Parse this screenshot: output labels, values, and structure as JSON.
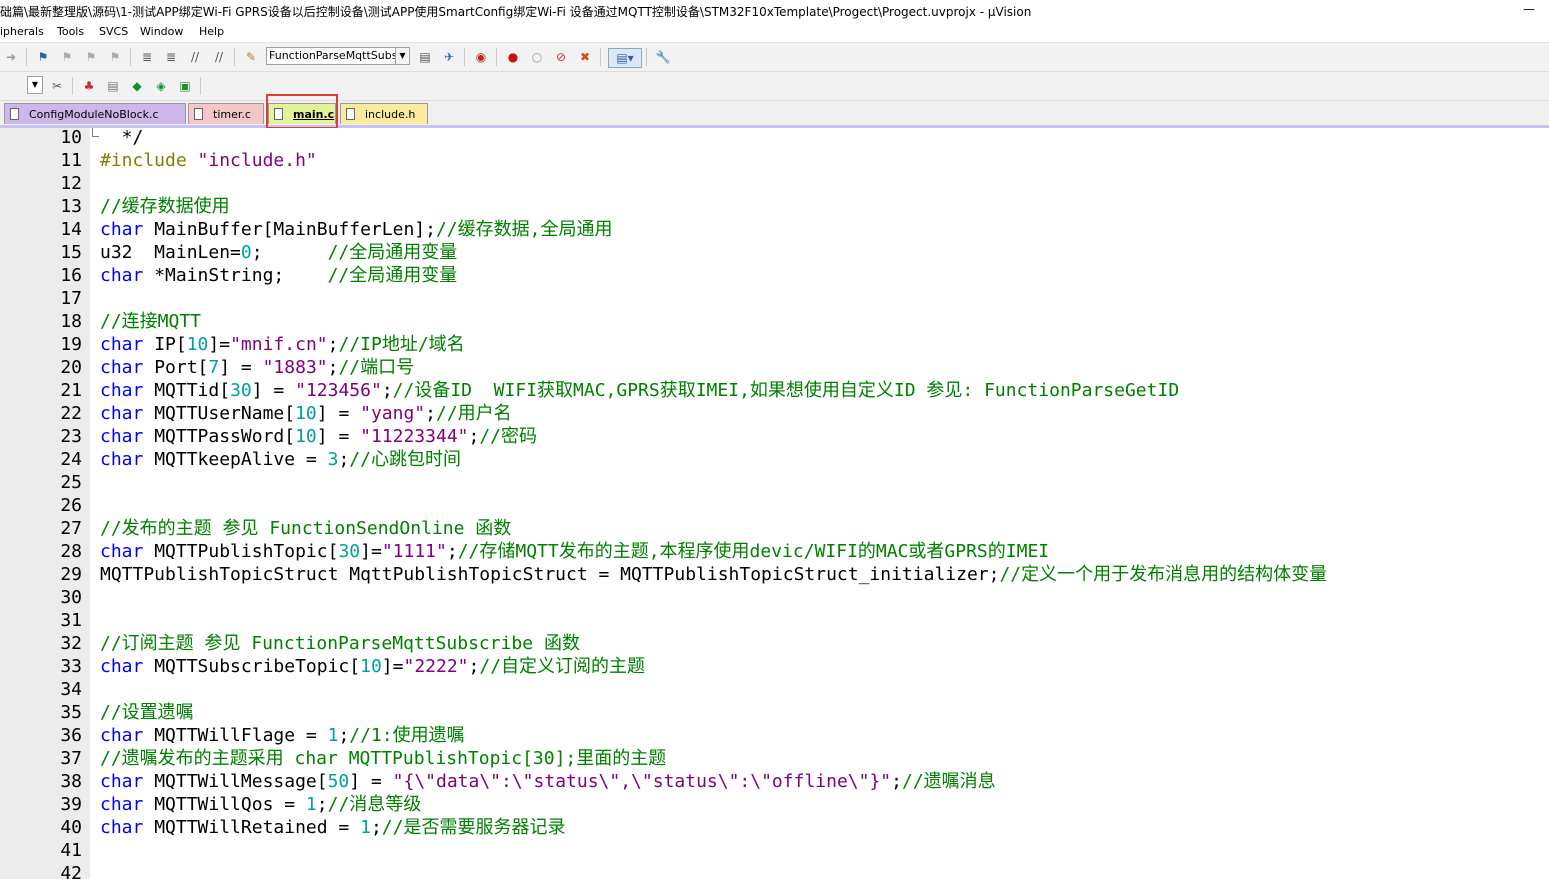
{
  "window": {
    "title": "础篇\\最新整理版\\源码\\1-测试APP绑定Wi-Fi  GPRS设备以后控制设备\\测试APP使用SmartConfig绑定Wi-Fi 设备通过MQTT控制设备\\STM32F10xTemplate\\Progect\\Progect.uvprojx - µVision",
    "minimize": "—"
  },
  "menu": [
    "ipherals",
    "Tools",
    "SVCS",
    "Window",
    "Help"
  ],
  "toolbar": {
    "function_combo": "FunctionParseMqttSubsc"
  },
  "tabs": [
    {
      "label": "ConfigModuleNoBlock.c",
      "color": "#cdb6e8"
    },
    {
      "label": "timer.c",
      "color": "#f3c7c7"
    },
    {
      "label": "main.c",
      "color": "#e6f29a"
    },
    {
      "label": "include.h",
      "color": "#fbeaa0"
    }
  ],
  "active_tab": "main.c",
  "code": {
    "lines": [
      {
        "n": "10",
        "t": [
          [
            "op",
            "  */"
          ]
        ]
      },
      {
        "n": "11",
        "t": [
          [
            "pp",
            "#include "
          ],
          [
            "st",
            "\"include.h\""
          ]
        ]
      },
      {
        "n": "12",
        "t": []
      },
      {
        "n": "13",
        "t": [
          [
            "cm",
            "//缓存数据使用"
          ]
        ]
      },
      {
        "n": "14",
        "t": [
          [
            "kw",
            "char"
          ],
          [
            "op",
            " MainBuffer[MainBufferLen];"
          ],
          [
            "cm",
            "//缓存数据,全局通用"
          ]
        ]
      },
      {
        "n": "15",
        "t": [
          [
            "op",
            "u32  MainLen="
          ],
          [
            "nm",
            "0"
          ],
          [
            "op",
            ";      "
          ],
          [
            "cm",
            "//全局通用变量"
          ]
        ]
      },
      {
        "n": "16",
        "t": [
          [
            "kw",
            "char"
          ],
          [
            "op",
            " *MainString;    "
          ],
          [
            "cm",
            "//全局通用变量"
          ]
        ]
      },
      {
        "n": "17",
        "t": []
      },
      {
        "n": "18",
        "t": [
          [
            "cm",
            "//连接MQTT"
          ]
        ]
      },
      {
        "n": "19",
        "t": [
          [
            "kw",
            "char"
          ],
          [
            "op",
            " IP["
          ],
          [
            "nm",
            "10"
          ],
          [
            "op",
            "]="
          ],
          [
            "st",
            "\"mnif.cn\""
          ],
          [
            "op",
            ";"
          ],
          [
            "cm",
            "//IP地址/域名"
          ]
        ]
      },
      {
        "n": "20",
        "t": [
          [
            "kw",
            "char"
          ],
          [
            "op",
            " Port["
          ],
          [
            "nm",
            "7"
          ],
          [
            "op",
            "] = "
          ],
          [
            "st",
            "\"1883\""
          ],
          [
            "op",
            ";"
          ],
          [
            "cm",
            "//端口号"
          ]
        ]
      },
      {
        "n": "21",
        "t": [
          [
            "kw",
            "char"
          ],
          [
            "op",
            " MQTTid["
          ],
          [
            "nm",
            "30"
          ],
          [
            "op",
            "] = "
          ],
          [
            "st",
            "\"123456\""
          ],
          [
            "op",
            ";"
          ],
          [
            "cm",
            "//设备ID  WIFI获取MAC,GPRS获取IMEI,如果想使用自定义ID 参见: FunctionParseGetID"
          ]
        ]
      },
      {
        "n": "22",
        "t": [
          [
            "kw",
            "char"
          ],
          [
            "op",
            " MQTTUserName["
          ],
          [
            "nm",
            "10"
          ],
          [
            "op",
            "] = "
          ],
          [
            "st",
            "\"yang\""
          ],
          [
            "op",
            ";"
          ],
          [
            "cm",
            "//用户名"
          ]
        ]
      },
      {
        "n": "23",
        "t": [
          [
            "kw",
            "char"
          ],
          [
            "op",
            " MQTTPassWord["
          ],
          [
            "nm",
            "10"
          ],
          [
            "op",
            "] = "
          ],
          [
            "st",
            "\"11223344\""
          ],
          [
            "op",
            ";"
          ],
          [
            "cm",
            "//密码"
          ]
        ]
      },
      {
        "n": "24",
        "t": [
          [
            "kw",
            "char"
          ],
          [
            "op",
            " MQTTkeepAlive = "
          ],
          [
            "nm",
            "3"
          ],
          [
            "op",
            ";"
          ],
          [
            "cm",
            "//心跳包时间"
          ]
        ]
      },
      {
        "n": "25",
        "t": []
      },
      {
        "n": "26",
        "t": []
      },
      {
        "n": "27",
        "t": [
          [
            "cm",
            "//发布的主题 参见 FunctionSendOnline 函数"
          ]
        ]
      },
      {
        "n": "28",
        "t": [
          [
            "kw",
            "char"
          ],
          [
            "op",
            " MQTTPublishTopic["
          ],
          [
            "nm",
            "30"
          ],
          [
            "op",
            "]="
          ],
          [
            "st",
            "\"1111\""
          ],
          [
            "op",
            ";"
          ],
          [
            "cm",
            "//存储MQTT发布的主题,本程序使用devic/WIFI的MAC或者GPRS的IMEI"
          ]
        ]
      },
      {
        "n": "29",
        "t": [
          [
            "op",
            "MQTTPublishTopicStruct MqttPublishTopicStruct = MQTTPublishTopicStruct_initializer;"
          ],
          [
            "cm",
            "//定义一个用于发布消息用的结构体变量"
          ]
        ]
      },
      {
        "n": "30",
        "t": []
      },
      {
        "n": "31",
        "t": []
      },
      {
        "n": "32",
        "t": [
          [
            "cm",
            "//订阅主题 参见 FunctionParseMqttSubscribe 函数"
          ]
        ]
      },
      {
        "n": "33",
        "t": [
          [
            "kw",
            "char"
          ],
          [
            "op",
            " MQTTSubscribeTopic["
          ],
          [
            "nm",
            "10"
          ],
          [
            "op",
            "]="
          ],
          [
            "st",
            "\"2222\""
          ],
          [
            "op",
            ";"
          ],
          [
            "cm",
            "//自定义订阅的主题"
          ]
        ]
      },
      {
        "n": "34",
        "t": []
      },
      {
        "n": "35",
        "t": [
          [
            "cm",
            "//设置遗嘱"
          ]
        ]
      },
      {
        "n": "36",
        "t": [
          [
            "kw",
            "char"
          ],
          [
            "op",
            " MQTTWillFlage = "
          ],
          [
            "nm",
            "1"
          ],
          [
            "op",
            ";"
          ],
          [
            "cm",
            "//1:使用遗嘱"
          ]
        ]
      },
      {
        "n": "37",
        "t": [
          [
            "cm",
            "//遗嘱发布的主题采用 char MQTTPublishTopic[30];里面的主题"
          ]
        ]
      },
      {
        "n": "38",
        "t": [
          [
            "kw",
            "char"
          ],
          [
            "op",
            " MQTTWillMessage["
          ],
          [
            "nm",
            "50"
          ],
          [
            "op",
            "] = "
          ],
          [
            "st",
            "\"{\\\"data\\\":\\\"status\\\",\\\"status\\\":\\\"offline\\\"}\""
          ],
          [
            "op",
            ";"
          ],
          [
            "cm",
            "//遗嘱消息"
          ]
        ]
      },
      {
        "n": "39",
        "t": [
          [
            "kw",
            "char"
          ],
          [
            "op",
            " MQTTWillQos = "
          ],
          [
            "nm",
            "1"
          ],
          [
            "op",
            ";"
          ],
          [
            "cm",
            "//消息等级"
          ]
        ]
      },
      {
        "n": "40",
        "t": [
          [
            "kw",
            "char"
          ],
          [
            "op",
            " MQTTWillRetained = "
          ],
          [
            "nm",
            "1"
          ],
          [
            "op",
            ";"
          ],
          [
            "cm",
            "//是否需要服务器记录"
          ]
        ]
      },
      {
        "n": "41",
        "t": []
      },
      {
        "n": "42",
        "t": []
      }
    ]
  }
}
